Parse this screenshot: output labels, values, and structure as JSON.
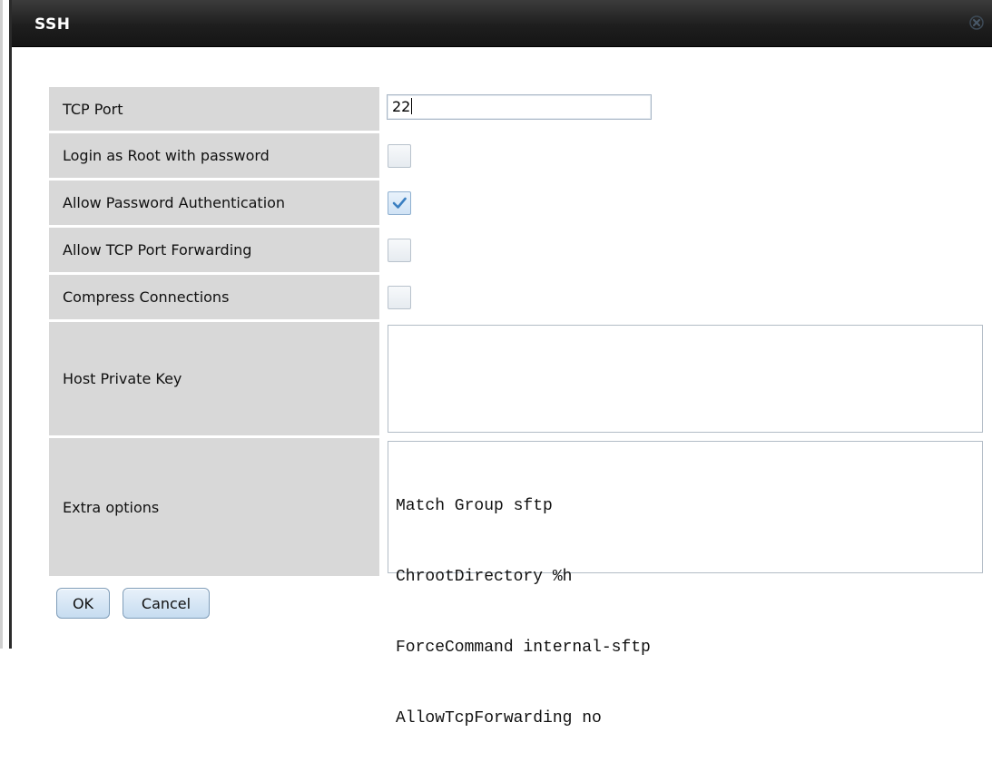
{
  "dialog": {
    "title": "SSH",
    "close_icon": "close-x-icon"
  },
  "fields": {
    "tcp_port": {
      "label": "TCP Port",
      "value": "22"
    },
    "login_root": {
      "label": "Login as Root with password",
      "checked": false
    },
    "allow_password_auth": {
      "label": "Allow Password Authentication",
      "checked": true
    },
    "allow_tcp_forwarding": {
      "label": "Allow TCP Port Forwarding",
      "checked": false
    },
    "compress_connections": {
      "label": "Compress Connections",
      "checked": false
    },
    "host_private_key": {
      "label": "Host Private Key",
      "value": ""
    },
    "extra_options": {
      "label": "Extra options",
      "lines": [
        "Match Group sftp",
        "ChrootDirectory %h",
        "ForceCommand internal-sftp",
        "AllowTcpForwarding no"
      ]
    }
  },
  "buttons": {
    "ok": "OK",
    "cancel": "Cancel"
  },
  "colors": {
    "titlebar": "#1e1e1e",
    "label_bg": "#d8d8d8",
    "button_bg": "#c6dcf0",
    "check_mark": "#3a7fc1"
  }
}
